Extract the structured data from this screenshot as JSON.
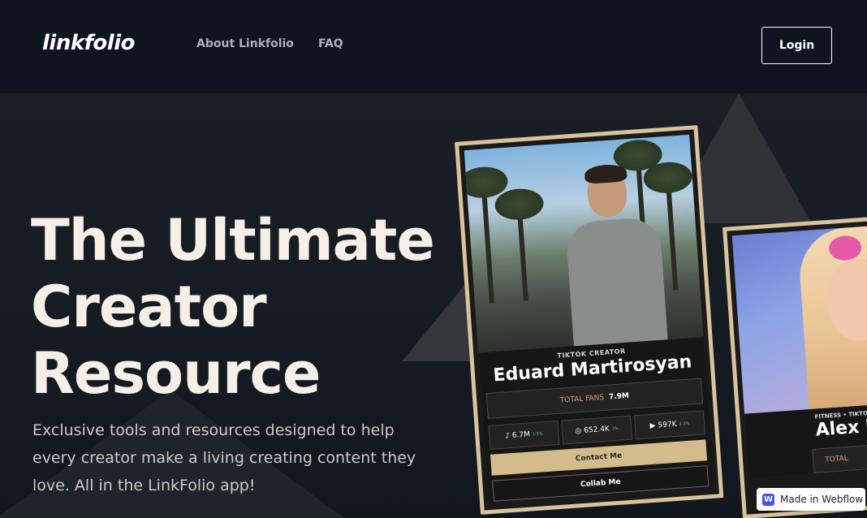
{
  "header": {
    "logo": "linkfolio",
    "nav": [
      "About Linkfolio",
      "FAQ"
    ],
    "login_label": "Login"
  },
  "hero": {
    "title": "The Ultimate Creator Resource",
    "subtitle": "Exclusive tools and resources designed to help every creator make a living creating content they love. All in the LinkFolio app!"
  },
  "card_primary": {
    "role": "TIKTOK CREATOR",
    "name": "Eduard Martirosyan",
    "total_fans_label": "TOTAL FANS",
    "total_fans_value": "7.9M",
    "stats": [
      {
        "icon": "tiktok-icon",
        "value": "6.7M",
        "delta": "1.5%"
      },
      {
        "icon": "instagram-icon",
        "value": "652.4K",
        "delta": "3%"
      },
      {
        "icon": "youtube-icon",
        "value": "597K",
        "delta": "2.3%"
      }
    ],
    "contact_label": "Contact Me",
    "collab_label": "Collab Me"
  },
  "card_secondary": {
    "role": "FITNESS • TIKTOK CREATOR",
    "name": "Alex D",
    "total_label": "TOTAL"
  },
  "badge": {
    "label": "Made in Webflow",
    "icon_letter": "W"
  },
  "colors": {
    "header_bg": "#0d1521",
    "accent_gold": "#d9c39a",
    "hero_text": "#f5efe6"
  }
}
